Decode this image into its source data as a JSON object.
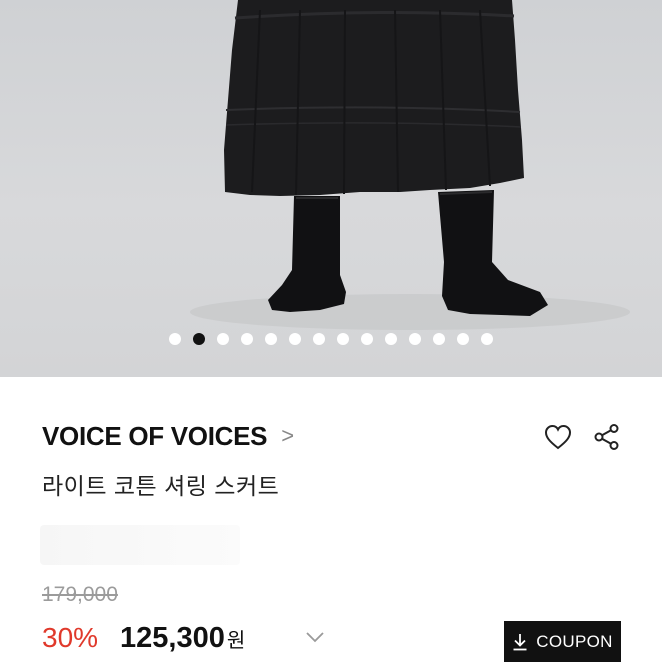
{
  "hero": {
    "image_description_icon": "product-photo",
    "dots_count": 14,
    "active_index": 1
  },
  "product": {
    "brand": "VOICE OF VOICES",
    "brand_chevron": ">",
    "name": "라이트 코튼 셔링 스커트",
    "original_price": "179,000",
    "discount": "30%",
    "price": "125,300",
    "currency": "원"
  },
  "actions": {
    "wishlist_icon": "heart-icon",
    "share_icon": "share-icon",
    "coupon_label": "COUPON",
    "coupon_icon": "download-icon"
  },
  "colors": {
    "discount": "#e0392b",
    "coupon_bg": "#111111"
  }
}
